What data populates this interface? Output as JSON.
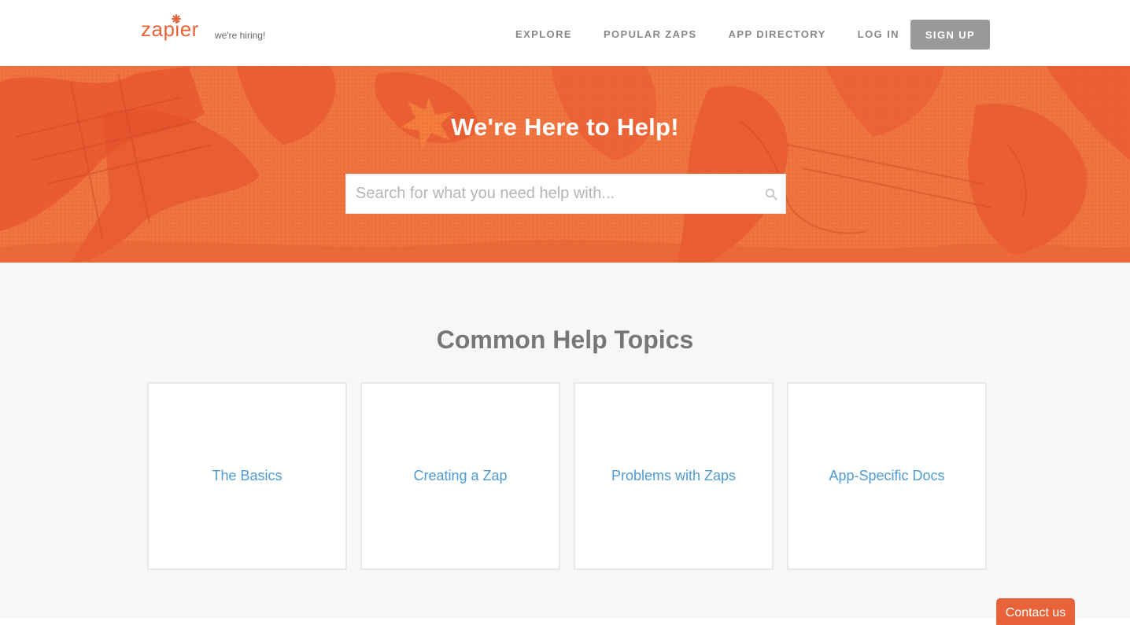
{
  "header": {
    "logo_text": "zapier",
    "hiring_label": "we're hiring!",
    "nav": {
      "explore": "EXPLORE",
      "popular_zaps": "POPULAR ZAPS",
      "app_directory": "APP DIRECTORY",
      "log_in": "LOG IN"
    },
    "signup_label": "SIGN UP"
  },
  "hero": {
    "title": "We're Here to Help!",
    "search_placeholder": "Search for what you need help with..."
  },
  "topics": {
    "heading": "Common Help Topics",
    "cards": [
      {
        "label": "The Basics"
      },
      {
        "label": "Creating a Zap"
      },
      {
        "label": "Problems with Zaps"
      },
      {
        "label": "App-Specific Docs"
      }
    ]
  },
  "contact": {
    "label": "Contact us"
  },
  "colors": {
    "brand": "#e8623a",
    "hero_bg": "#ee6e3b",
    "link": "#4f9bd6",
    "signup_bg": "#999999"
  },
  "icons": {
    "logo_star": "asterisk-icon",
    "search": "search-icon"
  }
}
